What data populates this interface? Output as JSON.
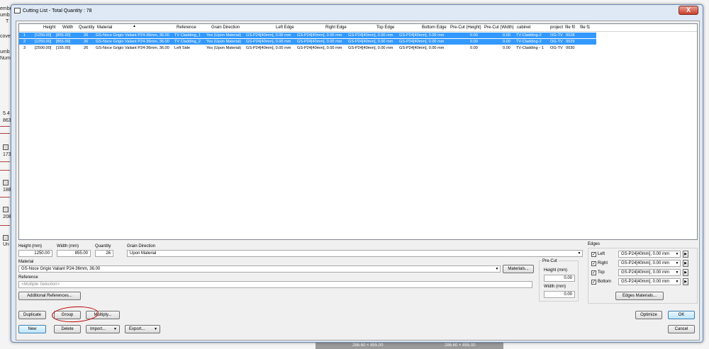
{
  "background": {
    "left_texts": [
      "ember",
      "umb",
      "T",
      "cove",
      "umb",
      "Num",
      "5.4",
      "863",
      "173",
      "188",
      "208",
      "Un"
    ]
  },
  "window": {
    "title": "Cutting List - Total Quantity : 78",
    "close_label": "X"
  },
  "grid": {
    "columns": [
      "Height",
      "Width",
      "Quantity",
      "Material",
      "Reference",
      "Grain Direction",
      "Left Edge",
      "Right Edge",
      "Top Edge",
      "Bottom Edge",
      "Pre-Cut (Height)",
      "Pre-Cut (Width)",
      "cabinet",
      "project",
      "file f0",
      "file f1"
    ],
    "rows": [
      {
        "num": "1",
        "height": "[1250.00]",
        "width": "[855.00]",
        "qty": "26",
        "material": "GS-Noce Grigio Valiant P24-36mm, 36.00",
        "reference": "TV Cladding_1",
        "grain": "Yes (Upon Material)",
        "left": "GS-P24[40mm], 0.00 mm",
        "right": "GS-P24[40mm], 0.00 mm",
        "top": "GS-P24[40mm], 0.00 mm",
        "bottom": "GS-P24[40mm], 0.00 mm",
        "pch": "0.00",
        "pcw": "0.00",
        "cabinet": "TV-Cladding-2",
        "project": "OG-TV",
        "f0": "0028",
        "selected": true
      },
      {
        "num": "2",
        "height": "[1250.00]",
        "width": "[855.00]",
        "qty": "26",
        "material": "GS-Noce Grigio Valiant P24-36mm, 36.00",
        "reference": "TV Cladding_2",
        "grain": "Yes (Upon Material)",
        "left": "GS-P24[40mm], 0.00 mm",
        "right": "GS-P24[40mm], 0.00 mm",
        "top": "GS-P24[40mm], 0.00 mm",
        "bottom": "GS-P24[40mm], 0.00 mm",
        "pch": "0.00",
        "pcw": "0.00",
        "cabinet": "TV-Cladding-2",
        "project": "OG-TV",
        "f0": "0029",
        "selected": true
      },
      {
        "num": "3",
        "height": "[2500.00]",
        "width": "[155.00]",
        "qty": "26",
        "material": "GS-Noce Grigio Valiant P24-36mm, 36.00",
        "reference": "Left Side",
        "grain": "Yes (Upon Material)",
        "left": "GS-P24[40mm], 0.00 mm",
        "right": "GS-P24[40mm], 0.00 mm",
        "top": "GS-P24[40mm], 0.00 mm",
        "bottom": "GS-P24[40mm], 0.00 mm",
        "pch": "0.00",
        "pcw": "0.00",
        "cabinet": "TV-Cladding - 1",
        "project": "OG-TV",
        "f0": "0030",
        "selected": false
      }
    ]
  },
  "form": {
    "height_label": "Height (mm)",
    "height_value": "1250.00",
    "width_label": "Width (mm)",
    "width_value": "855.00",
    "quantity_label": "Quantity",
    "quantity_value": "26",
    "grain_label": "Grain Direction",
    "grain_value": "Upon Material",
    "material_label": "Material",
    "material_value": "GS-Noce Grigio Valiant P24-36mm, 36.00",
    "materials_button": "Materials...",
    "reference_label": "Reference",
    "reference_placeholder": "<Multiple Selection>",
    "additional_references_button": "Additional References...",
    "precut_label": "Pre-Cut",
    "precut_height_label": "Height (mm)",
    "precut_height_value": "0.00",
    "precut_width_label": "Width (mm)",
    "precut_width_value": "0.00"
  },
  "edges": {
    "label": "Edges",
    "items": [
      {
        "name": "Left",
        "value": "GS-P24[40mm], 0.00 mm"
      },
      {
        "name": "Right",
        "value": "GS-P24[40mm], 0.00 mm"
      },
      {
        "name": "Top",
        "value": "GS-P24[40mm], 0.00 mm"
      },
      {
        "name": "Bottom",
        "value": "GS-P24[40mm], 0.00 mm"
      }
    ],
    "materials_button": "Edges Materials..."
  },
  "buttons": {
    "duplicate": "Duplicate",
    "group": "Group",
    "multiply": "Multiply...",
    "new": "New",
    "delete": "Delete",
    "import": "Import...",
    "export": "Export...",
    "optimize": "Optimize",
    "ok": "OK",
    "cancel": "Cancel"
  },
  "status": {
    "dim1": "286.60 × 855.00",
    "dim2": "286.60 × 855.00"
  }
}
